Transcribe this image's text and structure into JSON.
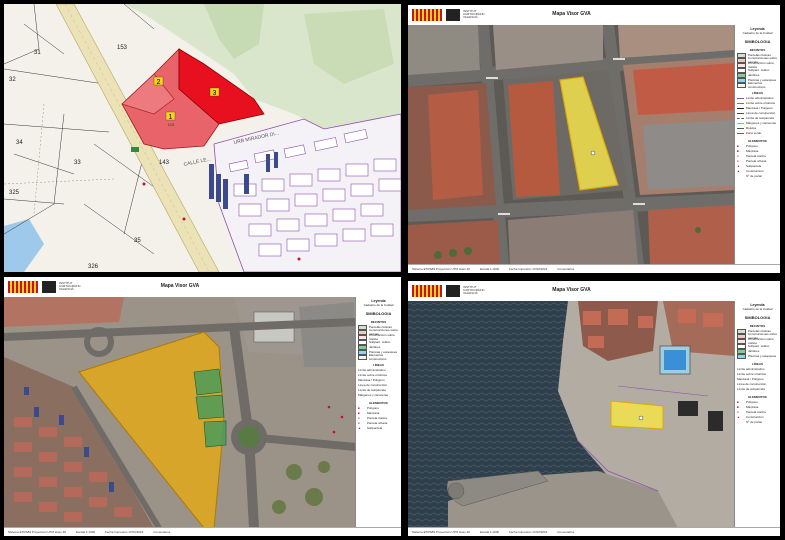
{
  "panel1": {
    "parcels": [
      {
        "number": "1",
        "sub": "119",
        "color": "#e8646a"
      },
      {
        "number": "2",
        "sub": "",
        "color": "#e8646a"
      },
      {
        "number": "3",
        "sub": "",
        "color": "#e8101e"
      }
    ],
    "plot_numbers": [
      "153",
      "31",
      "32",
      "33",
      "34",
      "35",
      "325",
      "326",
      "143"
    ],
    "streets": [
      "CALLE LE...",
      "URB MIRADOR DI..."
    ]
  },
  "viewer": {
    "title": "Mapa Visor GVA",
    "gov_name": "GENERALITAT VALENCIANA",
    "institute": "INSTITUT CARTOGRÀFIC VALENCIÀ",
    "legend_title": "Leyenda",
    "legend_subtitle": "Cadastro de la Cuidad",
    "legend_heading": "SIMBOLOGIA",
    "section_recintos": "RECINTOS",
    "section_lineas": "LÍNEAS",
    "section_elementos": "ELEMENTOS",
    "recintos": [
      {
        "label": "Parcelas rústicas",
        "color": "#cfe3c9"
      },
      {
        "label": "Construcciones sobre parcela",
        "color": "#f4c7c7"
      },
      {
        "label": "Construcción sobre rústica",
        "color": "#f9e5e5"
      },
      {
        "label": "Subparc. cultivo",
        "color": "#ffffff"
      },
      {
        "label": "Jardines",
        "color": "#7fd18c"
      },
      {
        "label": "Piscinas y estanques",
        "color": "#8fd7f0"
      },
      {
        "label": "Elementos constructivos",
        "color": "#f2f2f2"
      }
    ],
    "lineas": [
      "Límite administrativo",
      "Límite sobre ortofotos",
      "Manzana / Polígono",
      "Línea de construcción",
      "Límite de subparcela",
      "Márgenes y carreteras",
      "Rotulos",
      "Zona verde"
    ],
    "elementos": [
      "Polígono",
      "Manzana",
      "Parcela rústica",
      "Parcela urbana",
      "Subparcela",
      "Construcción",
      "Nº de portal"
    ],
    "footer": [
      "Sistema ETRS89 Proyección UTM Huso 30",
      "Escala 1:1000",
      "Fecha Impresión 17/02/2023",
      "Comentarios"
    ]
  }
}
